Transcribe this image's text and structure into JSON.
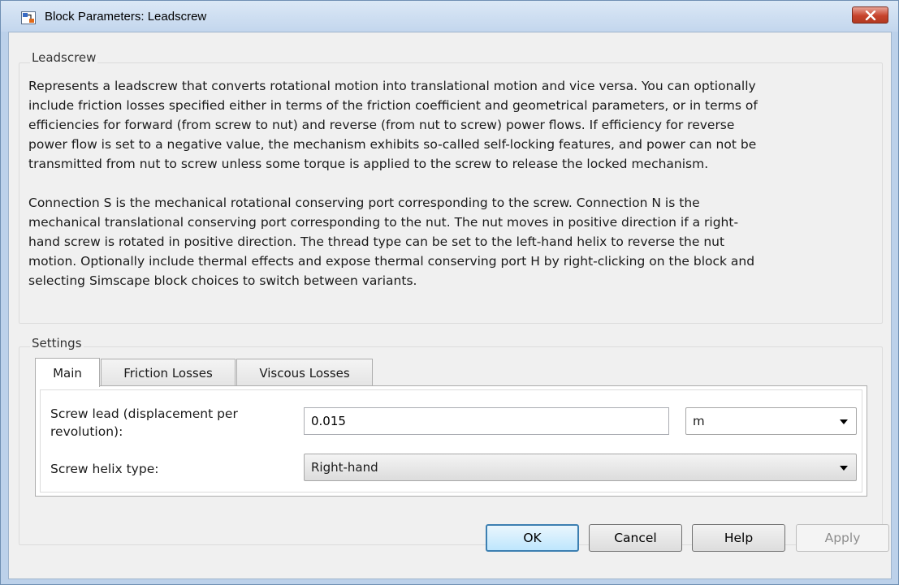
{
  "window": {
    "title": "Block Parameters: Leadscrew"
  },
  "description_group": {
    "label": "Leadscrew",
    "paragraph1": [
      "Represents a leadscrew that converts rotational motion into translational motion and vice versa. You can optionally",
      "include friction losses specified either in terms of the friction coefficient and geometrical parameters, or in terms of",
      "efficiencies for forward (from screw to nut) and reverse (from nut to screw) power flows. If efficiency for reverse",
      "power flow is set to a negative value, the mechanism exhibits so-called self-locking features, and power can not be",
      "transmitted from nut to screw unless some torque is applied to the screw to release the locked mechanism."
    ],
    "paragraph2": [
      "Connection S is the mechanical rotational conserving port corresponding to the screw. Connection N is the",
      "mechanical translational conserving port corresponding to the nut. The nut moves in positive direction if a right-",
      "hand screw is rotated in positive direction. The thread type can be set to the left-hand helix to reverse the nut",
      "motion. Optionally include thermal effects and expose thermal conserving port H by right-clicking on the block and",
      "selecting Simscape block choices to switch between variants."
    ]
  },
  "settings": {
    "label": "Settings",
    "tabs": [
      {
        "label": "Main",
        "active": true
      },
      {
        "label": "Friction Losses",
        "active": false
      },
      {
        "label": "Viscous Losses",
        "active": false
      }
    ],
    "screw_lead": {
      "label_line1": "Screw lead (displacement per",
      "label_line2": "revolution):",
      "value": "0.015",
      "unit": "m"
    },
    "helix_type": {
      "label": "Screw helix type:",
      "value": "Right-hand"
    }
  },
  "buttons": {
    "ok": "OK",
    "cancel": "Cancel",
    "help": "Help",
    "apply": "Apply"
  },
  "colors": {
    "title_bar": "#c3d6ed",
    "close_button": "#c7432c",
    "dialog_background": "#f0f0f0",
    "default_button_border": "#3c7fb1"
  }
}
